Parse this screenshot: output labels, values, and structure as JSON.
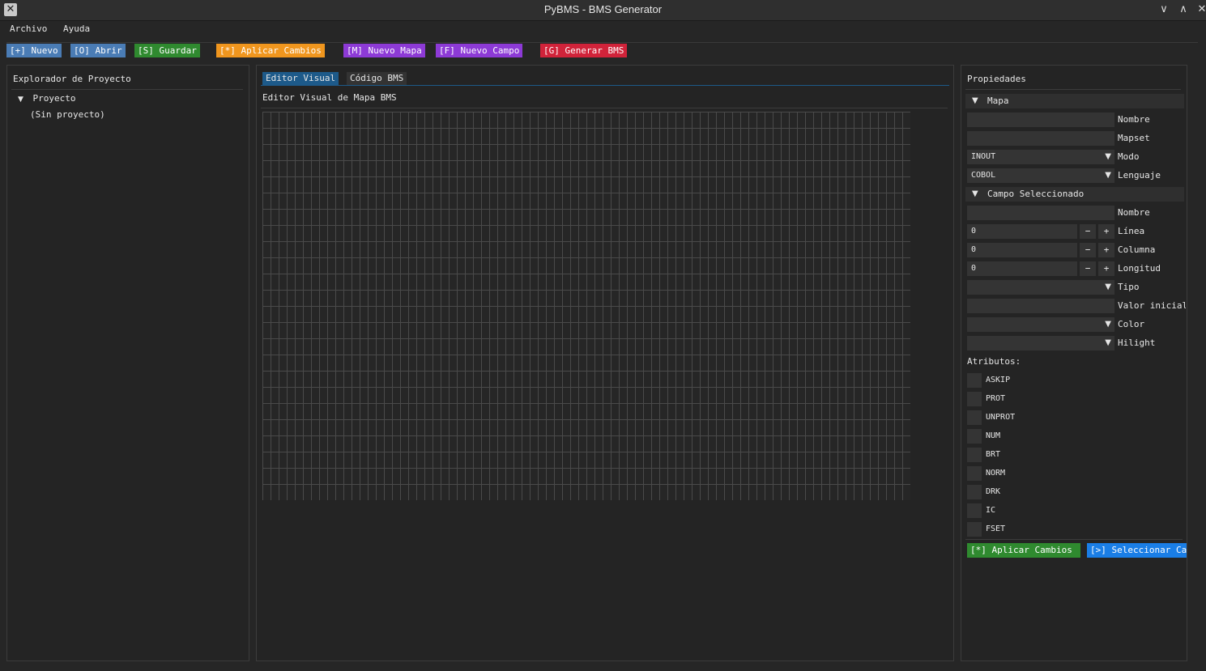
{
  "window": {
    "title": "PyBMS - BMS Generator",
    "controls": {
      "minimize": "∨",
      "maximize": "∧",
      "close": "✕"
    }
  },
  "menubar": {
    "items": [
      "Archivo",
      "Ayuda"
    ]
  },
  "toolbar": {
    "buttons": [
      {
        "label": "[+] Nuevo",
        "bg": "#4a7cb5",
        "color": "#ffffff"
      },
      {
        "label": "[O] Abrir",
        "bg": "#4a7cb5",
        "color": "#ffffff"
      },
      {
        "label": "[S] Guardar",
        "bg": "#2f8a2f",
        "color": "#ffffff"
      },
      {
        "label": "[*] Aplicar Cambios",
        "bg": "#f0961e",
        "color": "#ffffff"
      },
      {
        "label": "[M] Nuevo Mapa",
        "bg": "#8d3ad6",
        "color": "#ffffff"
      },
      {
        "label": "[F] Nuevo Campo",
        "bg": "#8d3ad6",
        "color": "#ffffff"
      },
      {
        "label": "[G] Generar BMS",
        "bg": "#d1233a",
        "color": "#ffffff"
      }
    ]
  },
  "explorer": {
    "title": "Explorador de Proyecto",
    "tree": {
      "arrow": "▼",
      "root": "Proyecto",
      "child": "(Sin proyecto)"
    }
  },
  "editor": {
    "tabs": [
      {
        "label": "Editor Visual",
        "active": true
      },
      {
        "label": "Código BMS",
        "active": false
      }
    ],
    "heading": "Editor Visual de Mapa BMS",
    "grid_color": "#4a4a4a"
  },
  "properties": {
    "title": "Propiedades",
    "mapa": {
      "header": "Mapa",
      "arrow": "▼",
      "fields": [
        {
          "label": "Nombre",
          "value": ""
        },
        {
          "label": "Mapset",
          "value": ""
        }
      ],
      "combos": [
        {
          "label": "Modo",
          "value": "INOUT"
        },
        {
          "label": "Lenguaje",
          "value": "COBOL"
        }
      ]
    },
    "campo": {
      "header": "Campo Seleccionado",
      "arrow": "▼",
      "nombre": {
        "label": "Nombre",
        "value": ""
      },
      "steppers": [
        {
          "label": "Línea",
          "value": "0"
        },
        {
          "label": "Columna",
          "value": "0"
        },
        {
          "label": "Longitud",
          "value": "0"
        }
      ],
      "minus": "−",
      "plus": "+",
      "tipo": {
        "label": "Tipo",
        "value": ""
      },
      "valor": {
        "label": "Valor inicial",
        "value": ""
      },
      "color": {
        "label": "Color",
        "value": ""
      },
      "hilight": {
        "label": "Hilight",
        "value": ""
      },
      "combo_arrow": "▼"
    },
    "atributos": {
      "label": "Atributos:",
      "items": [
        "ASKIP",
        "PROT",
        "UNPROT",
        "NUM",
        "BRT",
        "NORM",
        "DRK",
        "IC",
        "FSET"
      ]
    },
    "buttons": {
      "apply": {
        "label": "[*] Aplicar Cambios",
        "bg": "#2f8a2f"
      },
      "select": {
        "label": "[>] Seleccionar Campo",
        "bg": "#1a7ee6"
      }
    }
  }
}
